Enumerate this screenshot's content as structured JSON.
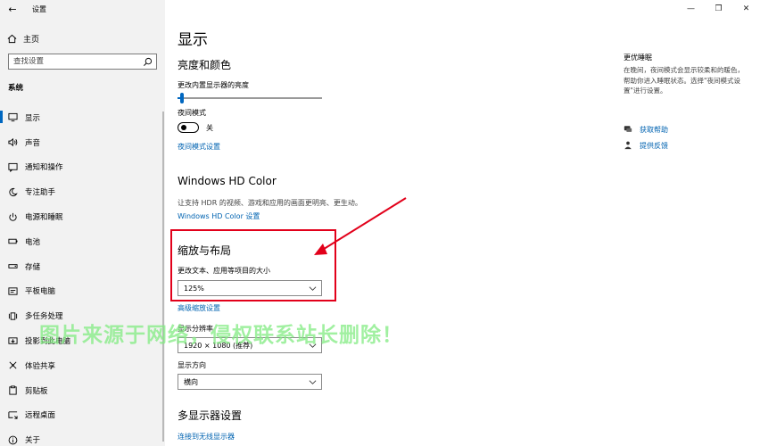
{
  "window": {
    "title": "设置",
    "back_symbol": "←",
    "minimize_symbol": "—",
    "maximize_symbol": "❐",
    "close_symbol": "✕"
  },
  "sidebar": {
    "home_label": "主页",
    "search_placeholder": "查找设置",
    "group_title": "系统",
    "items": [
      {
        "label": "显示",
        "icon": "monitor-icon",
        "active": true
      },
      {
        "label": "声音",
        "icon": "speaker-icon"
      },
      {
        "label": "通知和操作",
        "icon": "notification-icon"
      },
      {
        "label": "专注助手",
        "icon": "moon-icon"
      },
      {
        "label": "电源和睡眠",
        "icon": "power-icon"
      },
      {
        "label": "电池",
        "icon": "battery-icon"
      },
      {
        "label": "存储",
        "icon": "storage-icon"
      },
      {
        "label": "平板电脑",
        "icon": "tablet-icon"
      },
      {
        "label": "多任务处理",
        "icon": "multitask-icon"
      },
      {
        "label": "投影到此电脑",
        "icon": "projection-icon"
      },
      {
        "label": "体验共享",
        "icon": "share-icon"
      },
      {
        "label": "剪贴板",
        "icon": "clipboard-icon"
      },
      {
        "label": "远程桌面",
        "icon": "remote-desktop-icon"
      },
      {
        "label": "关于",
        "icon": "info-icon"
      }
    ]
  },
  "main": {
    "page_title": "显示",
    "brightness_section": {
      "title": "亮度和颜色",
      "brightness_label": "更改内置显示器的亮度",
      "brightness_value": 0.02,
      "night_light_label": "夜间模式",
      "night_light_state": "关",
      "night_light_settings_link": "夜间模式设置"
    },
    "hd_color_section": {
      "title": "Windows HD Color",
      "description": "让支持 HDR 的视频、游戏和应用的画面更明亮、更生动。",
      "settings_link": "Windows HD Color 设置"
    },
    "scale_section": {
      "title": "缩放与布局",
      "scale_label": "更改文本、应用等项目的大小",
      "scale_value": "125%",
      "advanced_link": "高级缩放设置",
      "resolution_label": "显示分辨率",
      "resolution_value": "1920 × 1080 (推荐)",
      "orientation_label": "显示方向",
      "orientation_value": "横向"
    },
    "multi_display_section": {
      "title": "多显示器设置",
      "wireless_link": "连接到无线显示器"
    }
  },
  "right_panel": {
    "title": "更优睡眠",
    "description": "在晚间，夜间模式会显示较柔和的暖色，帮助你进入睡眠状态。选择\"夜间模式设置\"进行设置。",
    "help_link": "获取帮助",
    "feedback_link": "提供反馈"
  },
  "annotation": {
    "highlight_color": "#e2001a"
  },
  "watermark": "图片来源于网络，侵权联系站长删除！",
  "colors": {
    "accent": "#0067c0",
    "link": "#0063b1",
    "sidebar_bg": "#f2f2f2"
  }
}
